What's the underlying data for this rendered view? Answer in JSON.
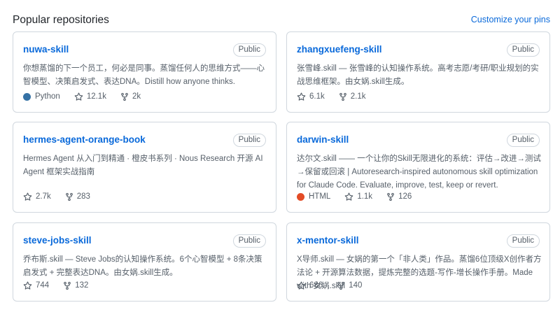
{
  "section": {
    "title": "Popular repositories",
    "customize_label": "Customize your pins"
  },
  "repos": [
    {
      "name": "nuwa-skill",
      "visibility": "Public",
      "description": "你想蒸馏的下一个员工，何必是同事。蒸馏任何人的思维方式——心智模型、决策启发式、表达DNA。Distill how anyone thinks.",
      "language": "Python",
      "language_color": "#3572A5",
      "stars": "12.1k",
      "forks": "2k"
    },
    {
      "name": "zhangxuefeng-skill",
      "visibility": "Public",
      "description": "张雪峰.skill — 张雪峰的认知操作系统。高考志愿/考研/职业规划的实战思维框架。由女娲.skill生成。",
      "language": "",
      "language_color": "",
      "stars": "6.1k",
      "forks": "2.1k"
    },
    {
      "name": "hermes-agent-orange-book",
      "visibility": "Public",
      "description": "Hermes Agent 从入门到精通 · 橙皮书系列 · Nous Research 开源 AI Agent 框架实战指南",
      "language": "",
      "language_color": "",
      "stars": "2.7k",
      "forks": "283"
    },
    {
      "name": "darwin-skill",
      "visibility": "Public",
      "description": "达尔文.skill —— 一个让你的Skill无限进化的系统：评估→改进→测试→保留或回滚 | Autoresearch-inspired autonomous skill optimization for Claude Code. Evaluate, improve, test, keep or revert.",
      "language": "HTML",
      "language_color": "#e34c26",
      "stars": "1.1k",
      "forks": "126"
    },
    {
      "name": "steve-jobs-skill",
      "visibility": "Public",
      "description": "乔布斯.skill — Steve Jobs的认知操作系统。6个心智模型 + 8条决策启发式 + 完整表达DNA。由女娲.skill生成。",
      "language": "",
      "language_color": "",
      "stars": "744",
      "forks": "132"
    },
    {
      "name": "x-mentor-skill",
      "visibility": "Public",
      "description": "X导师.skill — 女娲的第一个「非人类」作品。蒸馏6位顶级X创作者方法论 + 开源算法数据，提炼完整的选题-写作-增长操作手册。Made with 女娲.skill",
      "language": "",
      "language_color": "",
      "stars": "686",
      "forks": "140"
    }
  ],
  "icons": {
    "star": "star-icon",
    "fork": "repo-forked-icon"
  },
  "colors": {
    "link": "#0969da",
    "muted": "#57606a",
    "border": "#d0d7de"
  }
}
